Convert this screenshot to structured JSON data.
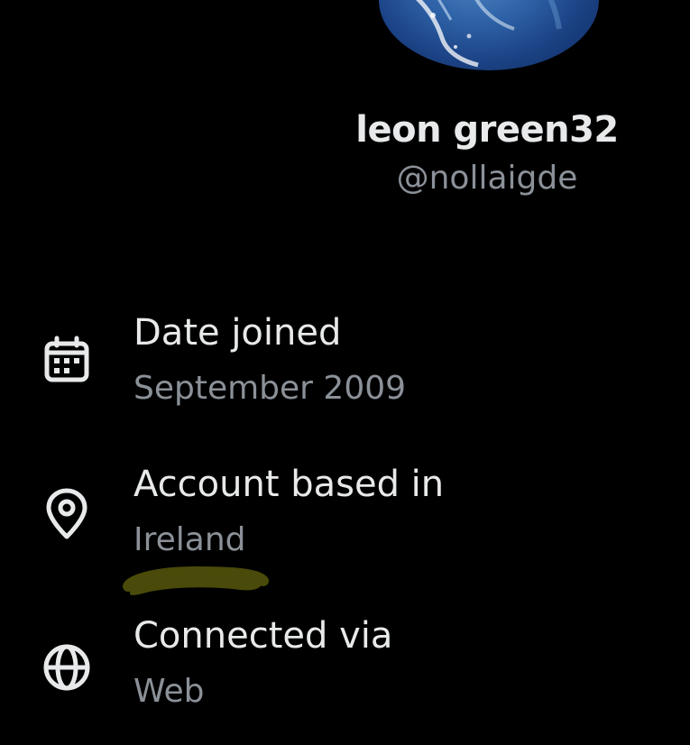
{
  "profile": {
    "display_name": "leon green32",
    "handle": "@nollaigde"
  },
  "about": {
    "date_joined": {
      "label": "Date joined",
      "value": "September 2009",
      "icon": "calendar-icon"
    },
    "account_based_in": {
      "label": "Account based in",
      "value": "Ireland",
      "icon": "location-pin-icon"
    },
    "connected_via": {
      "label": "Connected via",
      "value": "Web",
      "icon": "globe-icon"
    }
  },
  "colors": {
    "background": "#000000",
    "primary_text": "#e7e9ea",
    "secondary_text": "#8b9198",
    "marker_highlight": "#4a4a0a"
  }
}
